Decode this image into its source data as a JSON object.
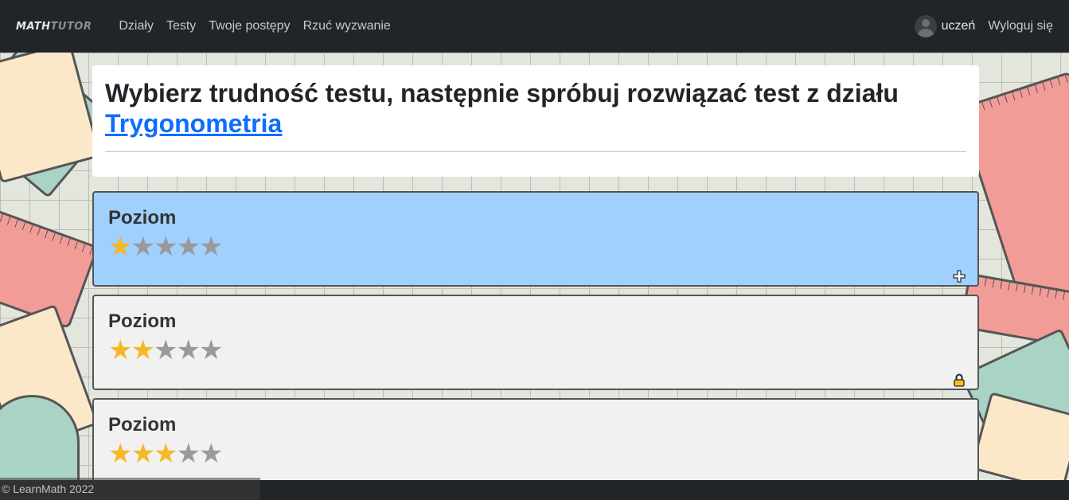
{
  "navbar": {
    "brand_part1": "MATH",
    "brand_part2": "TUTOR",
    "links": [
      "Działy",
      "Testy",
      "Twoje postępy",
      "Rzuć wyzwanie"
    ],
    "user_name": "uczeń",
    "logout_label": "Wyloguj się"
  },
  "header": {
    "title": "Wybierz trudność testu, następnie spróbuj rozwiązać test z działu",
    "section_link": "Trygonometria"
  },
  "levels": [
    {
      "label": "Poziom",
      "stars": 1,
      "max_stars": 5,
      "state": "active",
      "icon": "plus-icon"
    },
    {
      "label": "Poziom",
      "stars": 2,
      "max_stars": 5,
      "state": "locked",
      "icon": "lock-icon"
    },
    {
      "label": "Poziom",
      "stars": 3,
      "max_stars": 5,
      "state": "locked",
      "icon": ""
    }
  ],
  "footer": {
    "copyright": "© LearnMath 2022"
  },
  "colors": {
    "navbar_bg": "#212529",
    "active_level_bg": "#9fd0fe",
    "inactive_level_bg": "#f1f1f1",
    "star_on": "#f6b824",
    "star_off": "#9a9a9a",
    "link": "#0d6efd"
  }
}
